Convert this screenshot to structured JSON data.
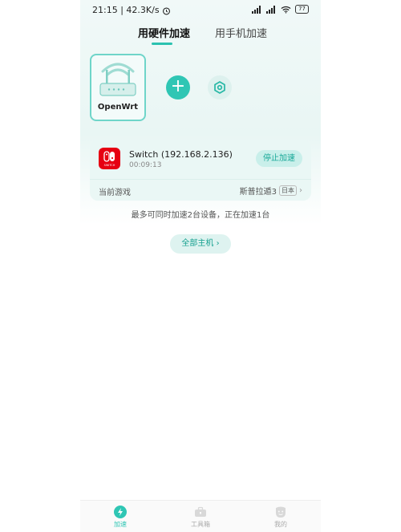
{
  "status_bar": {
    "time": "21:15",
    "speed": "42.3K/s",
    "battery": "77",
    "icons": [
      "alarm-icon",
      "signal-icon",
      "signal-icon",
      "wifi-icon",
      "battery-icon"
    ]
  },
  "tabs": [
    {
      "label": "用硬件加速",
      "active": true
    },
    {
      "label": "用手机加速",
      "active": false
    }
  ],
  "router": {
    "name": "OpenWrt"
  },
  "device": {
    "name": "Switch (192.168.2.136)",
    "duration": "00:09:13",
    "stop_label": "停止加速",
    "current_game_label": "当前游戏",
    "game_name": "斯普拉遁3",
    "region": "日本"
  },
  "info_text": "最多可同时加速2台设备，正在加速1台",
  "all_hosts_label": "全部主机",
  "bottom_nav": [
    {
      "label": "加速",
      "icon": "lightning-icon",
      "active": true
    },
    {
      "label": "工具箱",
      "icon": "toolbox-icon",
      "active": false
    },
    {
      "label": "我的",
      "icon": "profile-icon",
      "active": false
    }
  ],
  "colors": {
    "accent": "#2fc6b4",
    "switch_red": "#e60012"
  }
}
